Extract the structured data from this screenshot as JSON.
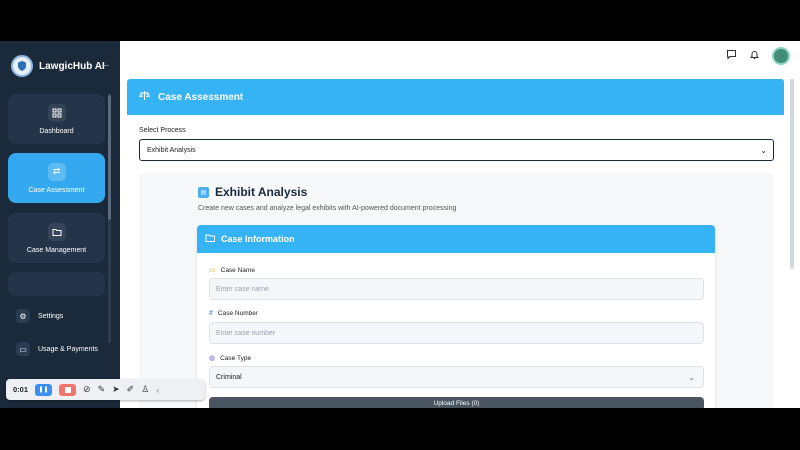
{
  "app": {
    "name": "LawgicHub AI",
    "collapse_icon": "arrow-left-icon"
  },
  "sidebar": {
    "items": [
      {
        "label": "Dashboard",
        "icon": "grid-icon",
        "active": false
      },
      {
        "label": "Case Assessment",
        "icon": "swap-arrows-icon",
        "active": true
      },
      {
        "label": "Case Management",
        "icon": "folder-icon",
        "active": false
      }
    ],
    "bottom": [
      {
        "label": "Settings",
        "icon": "gear-icon"
      },
      {
        "label": "Usage & Payments",
        "icon": "card-icon"
      }
    ]
  },
  "topbar": {
    "icons": [
      "message-icon",
      "bell-icon",
      "avatar"
    ]
  },
  "header": {
    "title": "Case Assessment",
    "icon": "scale-icon"
  },
  "process": {
    "label": "Select Process",
    "value": "Exhibit Analysis"
  },
  "exhibit": {
    "title": "Exhibit Analysis",
    "subtitle": "Create new cases and analyze legal exhibits with AI-powered document processing"
  },
  "case_info": {
    "title": "Case Information",
    "case_name_label": "Case Name",
    "case_name_placeholder": "Enter case name",
    "case_number_label": "Case Number",
    "case_number_placeholder": "Enter case number",
    "case_type_label": "Case Type",
    "case_type_value": "Criminal",
    "upload_label": "Upload Files (0)"
  },
  "recorder": {
    "time": "0:01"
  },
  "colors": {
    "accent": "#35b3f4",
    "sidebar": "#1b2a3a",
    "active_nav": "#35a9ef"
  }
}
